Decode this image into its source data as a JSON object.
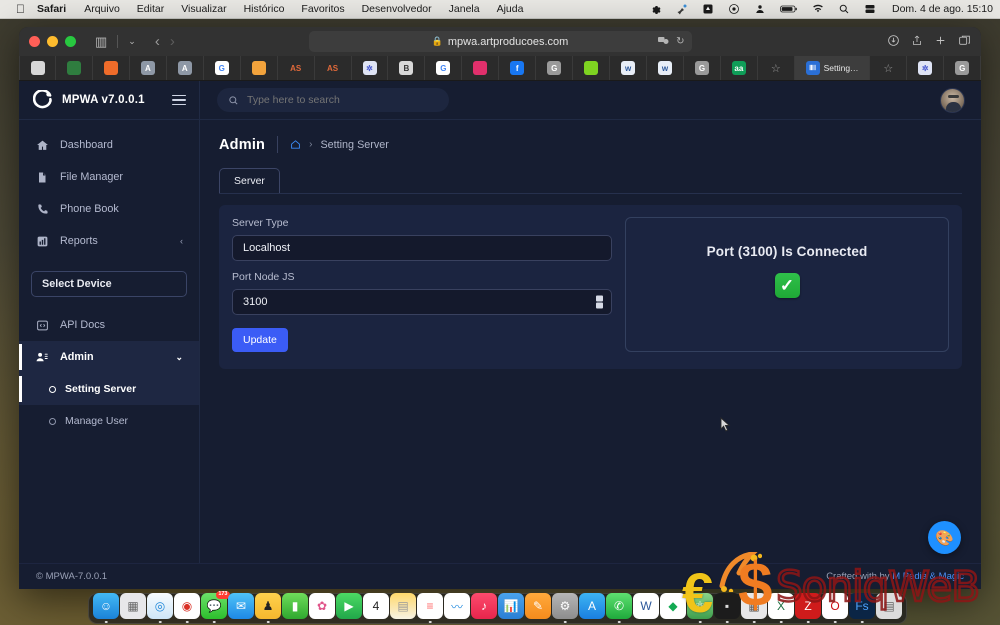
{
  "os_menubar": {
    "apple_glyph": "",
    "items": [
      {
        "label": "Safari",
        "bold": true
      },
      {
        "label": "Arquivo",
        "bold": false
      },
      {
        "label": "Editar",
        "bold": false
      },
      {
        "label": "Visualizar",
        "bold": false
      },
      {
        "label": "Histórico",
        "bold": false
      },
      {
        "label": "Favoritos",
        "bold": false
      },
      {
        "label": "Desenvolvedor",
        "bold": false
      },
      {
        "label": "Janela",
        "bold": false
      },
      {
        "label": "Ajuda",
        "bold": false
      }
    ],
    "status_icons": [
      "gear-icon",
      "cleaner-icon",
      "display-icon",
      "record-icon",
      "user-icon",
      "battery-icon",
      "wifi-icon",
      "search-icon",
      "control-center-icon"
    ],
    "clock": "Dom. 4 de ago.  15:10"
  },
  "browser": {
    "url": "mpwa.artproducoes.com",
    "lock_glyph": "🔒",
    "reload_glyph": "↻",
    "sidebar_glyph": "▥",
    "chevron_glyph": "⌄",
    "back_glyph": "‹",
    "forward_glyph": "›",
    "right_icons": [
      "downloads-icon",
      "share-icon",
      "new-tab-icon",
      "tab-overview-icon"
    ],
    "tabs": [
      {
        "name": "tab-globe",
        "letter": "",
        "color": "#d7d7d7",
        "text": "#333"
      },
      {
        "name": "tab-colorful",
        "letter": "",
        "color": "#2f7d3f",
        "text": "#fff"
      },
      {
        "name": "tab-orange",
        "letter": "",
        "color": "#ef6c2a",
        "text": "#fff"
      },
      {
        "name": "tab-a1",
        "letter": "A",
        "color": "#8e98a6",
        "text": "#fff"
      },
      {
        "name": "tab-a2",
        "letter": "A",
        "color": "#8e98a6",
        "text": "#fff"
      },
      {
        "name": "tab-google-1",
        "letter": "G",
        "color": "#ffffff",
        "text": "#4285f4"
      },
      {
        "name": "tab-cloud",
        "letter": "",
        "color": "#f2a33c",
        "text": "#fff"
      },
      {
        "name": "tab-as-1",
        "letter": "AS",
        "color": "#2b2b2b",
        "text": "#e0693a"
      },
      {
        "name": "tab-as-2",
        "letter": "AS",
        "color": "#2b2b2b",
        "text": "#e0693a"
      },
      {
        "name": "tab-settings",
        "letter": "✲",
        "color": "#dfe4f5",
        "text": "#4a5bd0"
      },
      {
        "name": "tab-b",
        "letter": "B",
        "color": "#d8d8d8",
        "text": "#333"
      },
      {
        "name": "tab-google-2",
        "letter": "G",
        "color": "#ffffff",
        "text": "#4285f4"
      },
      {
        "name": "tab-instagram",
        "letter": "",
        "color": "#e1306c",
        "text": "#fff"
      },
      {
        "name": "tab-facebook",
        "letter": "f",
        "color": "#1877f2",
        "text": "#fff"
      },
      {
        "name": "tab-g-grey-1",
        "letter": "G",
        "color": "#9a9a9a",
        "text": "#fff"
      },
      {
        "name": "tab-green",
        "letter": "",
        "color": "#7ed321",
        "text": "#fff"
      },
      {
        "name": "tab-word-1",
        "letter": "w",
        "color": "#e8eef7",
        "text": "#2b579a"
      },
      {
        "name": "tab-word-2",
        "letter": "w",
        "color": "#e8eef7",
        "text": "#2b579a"
      },
      {
        "name": "tab-g-grey-2",
        "letter": "G",
        "color": "#9a9a9a",
        "text": "#fff"
      },
      {
        "name": "tab-aa",
        "letter": "aa",
        "color": "#0f9d58",
        "text": "#fff"
      }
    ],
    "star_glyph": "☆",
    "active_tab": {
      "label": "Setting…",
      "icon_letter": "ⅢⅠ",
      "icon_color": "#2a6fd6"
    },
    "trailing_tabs": [
      {
        "name": "tab-settings-2",
        "letter": "✲",
        "color": "#dfe4f5",
        "text": "#4a5bd0"
      },
      {
        "name": "tab-g-grey-3",
        "letter": "G",
        "color": "#9a9a9a",
        "text": "#fff"
      }
    ]
  },
  "app": {
    "brand": "MPWA v7.0.0.1",
    "search_placeholder": "Type here to search",
    "search_value": "",
    "sidebar": {
      "items": [
        {
          "label": "Dashboard",
          "icon": "home-icon",
          "active": false,
          "chevron": ""
        },
        {
          "label": "File Manager",
          "icon": "file-icon",
          "active": false,
          "chevron": ""
        },
        {
          "label": "Phone Book",
          "icon": "phone-icon",
          "active": false,
          "chevron": ""
        },
        {
          "label": "Reports",
          "icon": "bar-chart-icon",
          "active": false,
          "chevron": "‹"
        }
      ],
      "select_device": "Select Device",
      "items2": [
        {
          "label": "API Docs",
          "icon": "code-icon",
          "active": false,
          "chevron": ""
        },
        {
          "label": "Admin",
          "icon": "user-cog-icon",
          "active": true,
          "chevron": "⌄"
        }
      ],
      "subitems": [
        {
          "label": "Setting Server",
          "active": true
        },
        {
          "label": "Manage User",
          "active": false
        }
      ]
    },
    "page_title": "Admin",
    "breadcrumb": {
      "home_icon": "home-icon",
      "separator": "›",
      "current": "Setting Server"
    },
    "tabs": [
      {
        "label": "Server",
        "active": true
      }
    ],
    "form": {
      "server_type_label": "Server Type",
      "server_type_value": "Localhost",
      "port_label": "Port Node JS",
      "port_value": "3100",
      "update_label": "Update"
    },
    "status": {
      "text": "Port (3100) Is Connected",
      "check_glyph": "✓",
      "check_color": "#22b14c"
    },
    "fab_icon": "🎨",
    "footer": {
      "copyright": "© MPWA-7.0.0.1",
      "credit_prefix": "Crafted with by ",
      "credit_link": "M Pedia & Magic"
    }
  },
  "watermark": {
    "euro": "€",
    "dollar": "$",
    "word": "SoniqWeB"
  },
  "dock": {
    "items": [
      {
        "name": "finder",
        "glyph": "☺",
        "bg": "linear-gradient(180deg,#43b9f5,#1b82d8)",
        "color": "#fff",
        "running": true,
        "badge": ""
      },
      {
        "name": "launchpad",
        "glyph": "▦",
        "bg": "#e7e7ea",
        "color": "#666",
        "running": false,
        "badge": ""
      },
      {
        "name": "safari",
        "glyph": "◎",
        "bg": "linear-gradient(180deg,#f7fbfe,#cfe6f7)",
        "color": "#1e86d8",
        "running": true,
        "badge": ""
      },
      {
        "name": "chrome",
        "glyph": "◉",
        "bg": "#fff",
        "color": "#d93025",
        "running": true,
        "badge": ""
      },
      {
        "name": "messages",
        "glyph": "💬",
        "bg": "linear-gradient(180deg,#6ce06a,#2cbf2c)",
        "color": "#fff",
        "running": true,
        "badge": "173"
      },
      {
        "name": "mail",
        "glyph": "✉",
        "bg": "linear-gradient(180deg,#4fc3f7,#1e88e5)",
        "color": "#fff",
        "running": false,
        "badge": ""
      },
      {
        "name": "keynote-a",
        "glyph": "♟",
        "bg": "linear-gradient(180deg,#ffd24d,#f5b82e)",
        "color": "#222",
        "running": true,
        "badge": ""
      },
      {
        "name": "numbers",
        "glyph": "▮",
        "bg": "linear-gradient(180deg,#6fdc5a,#2fa82f)",
        "color": "#fff",
        "running": false,
        "badge": ""
      },
      {
        "name": "photos",
        "glyph": "✿",
        "bg": "#fff",
        "color": "#e0558a",
        "running": false,
        "badge": ""
      },
      {
        "name": "facetime",
        "glyph": "▶",
        "bg": "linear-gradient(180deg,#4cd964,#21a84a)",
        "color": "#fff",
        "running": false,
        "badge": ""
      },
      {
        "name": "calendar",
        "glyph": "4",
        "bg": "#fff",
        "color": "#222",
        "running": false,
        "badge": ""
      },
      {
        "name": "notes",
        "glyph": "▤",
        "bg": "linear-gradient(180deg,#ffd86b,#f7f3e3)",
        "color": "#999",
        "running": false,
        "badge": ""
      },
      {
        "name": "reminders",
        "glyph": "≡",
        "bg": "#fff",
        "color": "#ff6b6b",
        "running": true,
        "badge": ""
      },
      {
        "name": "freeform",
        "glyph": "〰",
        "bg": "#fff",
        "color": "#2b8fe0",
        "running": false,
        "badge": ""
      },
      {
        "name": "music",
        "glyph": "♪",
        "bg": "linear-gradient(180deg,#fc4b6d,#e8254c)",
        "color": "#fff",
        "running": false,
        "badge": ""
      },
      {
        "name": "keynote",
        "glyph": "📊",
        "bg": "linear-gradient(180deg,#4aa3ec,#2a7fd4)",
        "color": "#fff",
        "running": false,
        "badge": ""
      },
      {
        "name": "pages",
        "glyph": "✎",
        "bg": "linear-gradient(180deg,#ffa93c,#f48b1c)",
        "color": "#fff",
        "running": false,
        "badge": ""
      },
      {
        "name": "settings",
        "glyph": "⚙",
        "bg": "linear-gradient(180deg,#b6b6b6,#8d8d8d)",
        "color": "#fff",
        "running": true,
        "badge": ""
      },
      {
        "name": "appstore",
        "glyph": "A",
        "bg": "linear-gradient(180deg,#3db4f2,#1a7fe0)",
        "color": "#fff",
        "running": false,
        "badge": ""
      },
      {
        "name": "whatsapp",
        "glyph": "✆",
        "bg": "linear-gradient(180deg,#5ee070,#1faa3c)",
        "color": "#fff",
        "running": true,
        "badge": ""
      },
      {
        "name": "word",
        "glyph": "W",
        "bg": "#fff",
        "color": "#2b579a",
        "running": false,
        "badge": ""
      },
      {
        "name": "mongodb",
        "glyph": "◆",
        "bg": "#fff",
        "color": "#13aa52",
        "running": false,
        "badge": ""
      },
      {
        "name": "atom",
        "glyph": "⚛",
        "bg": "linear-gradient(180deg,#8ad68a,#3f9e4d)",
        "color": "#fff",
        "running": true,
        "badge": ""
      },
      {
        "name": "terminal",
        "glyph": "▪",
        "bg": "#1c1c1c",
        "color": "#ddd",
        "running": true,
        "badge": ""
      },
      {
        "name": "photoshop-e",
        "glyph": "▦",
        "bg": "#e8e8e8",
        "color": "#555",
        "running": true,
        "badge": ""
      },
      {
        "name": "excel",
        "glyph": "X",
        "bg": "#fff",
        "color": "#1d6f42",
        "running": true,
        "badge": ""
      },
      {
        "name": "zed",
        "glyph": "Z",
        "bg": "#cf1b1b",
        "color": "#fff",
        "running": true,
        "badge": ""
      },
      {
        "name": "opera",
        "glyph": "O",
        "bg": "#fff",
        "color": "#cc0f16",
        "running": true,
        "badge": ""
      },
      {
        "name": "fonts",
        "glyph": "Fs",
        "bg": "#0b2545",
        "color": "#4ea3ff",
        "running": true,
        "badge": ""
      },
      {
        "name": "preview",
        "glyph": "▤",
        "bg": "#dcdcdc",
        "color": "#666",
        "running": false,
        "badge": ""
      }
    ]
  }
}
